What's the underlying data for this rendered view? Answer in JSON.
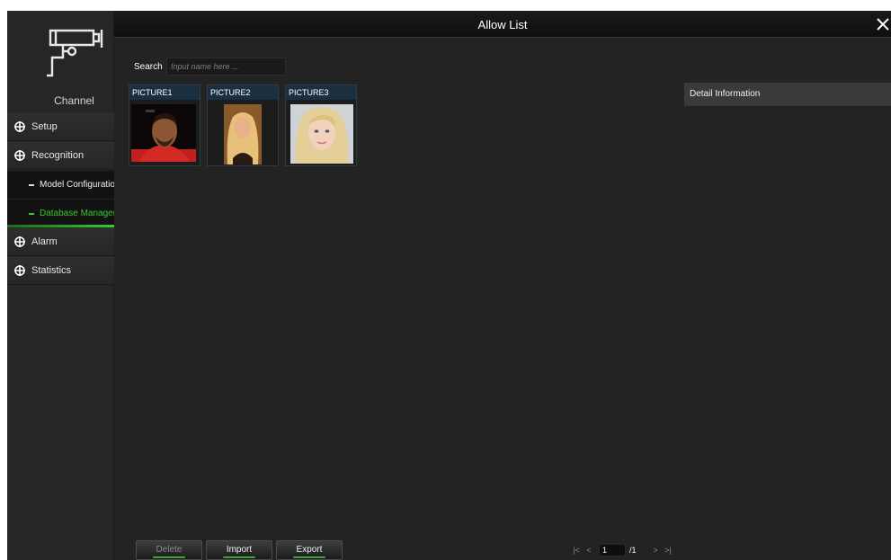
{
  "window": {
    "title": "Allow List"
  },
  "sidebar": {
    "channel_label": "Channel",
    "items": [
      {
        "label": "Setup",
        "icon": "crosshair-icon"
      },
      {
        "label": "Recognition",
        "icon": "crosshair-icon"
      },
      {
        "label": "Model Configuration",
        "sub": true
      },
      {
        "label": "Database Management",
        "sub": true,
        "active": true
      },
      {
        "label": "Alarm",
        "icon": "crosshair-icon"
      },
      {
        "label": "Statistics",
        "icon": "crosshair-icon"
      }
    ]
  },
  "search": {
    "label": "Search",
    "placeholder": "Input name here ..."
  },
  "pictures": [
    {
      "label": "PICTURE1"
    },
    {
      "label": "PICTURE2"
    },
    {
      "label": "PICTURE3"
    }
  ],
  "detail": {
    "title": "Detail Information"
  },
  "actions": {
    "delete": "Delete",
    "import": "Import",
    "export": "Export"
  },
  "pagination": {
    "current": "1",
    "total": "/1"
  },
  "colors": {
    "accent": "#35c92f",
    "header": "#1b2f43",
    "background": "#232323"
  }
}
